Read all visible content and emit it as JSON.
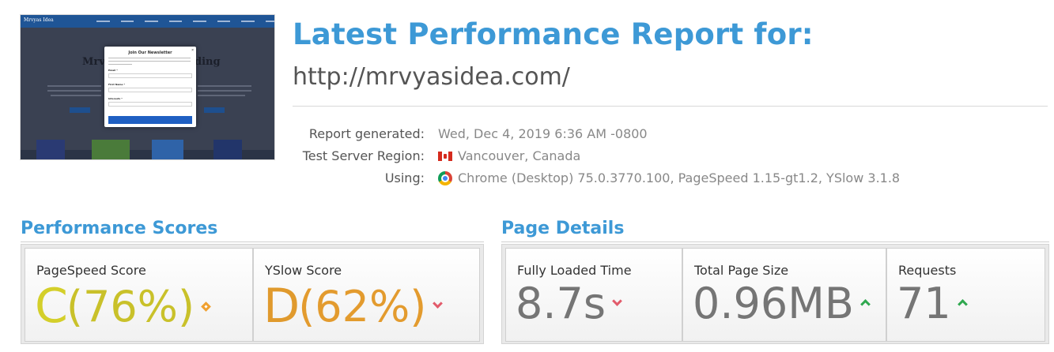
{
  "thumbnail": {
    "site_logo": "Mrvyas Idea",
    "hero_title_left": "Mrv",
    "hero_title_right": "ding",
    "modal_title": "Join Our Newsletter",
    "modal_close": "×",
    "modal_labels": [
      "Email *",
      "First Name *",
      "Interests *"
    ]
  },
  "header": {
    "title": "Latest Performance Report for:",
    "url": "http://mrvyasidea.com/"
  },
  "report_meta": [
    {
      "label": "Report generated:",
      "value": "Wed, Dec 4, 2019 6:36 AM -0800",
      "icon": ""
    },
    {
      "label": "Test Server Region:",
      "value": "Vancouver, Canada",
      "icon": "canada-flag-icon"
    },
    {
      "label": "Using:",
      "value": "Chrome (Desktop) 75.0.3770.100, PageSpeed 1.15-gt1.2, YSlow 3.1.8",
      "icon": "chrome-icon"
    }
  ],
  "performance_scores": {
    "heading": "Performance Scores",
    "pagespeed": {
      "label": "PageSpeed Score",
      "grade": "C",
      "percent": "(76%)",
      "trend": "neutral",
      "grade_color": "#d4cf2a",
      "percent_color": "#c9c12a"
    },
    "yslow": {
      "label": "YSlow Score",
      "grade": "D",
      "percent": "(62%)",
      "trend": "down",
      "grade_color": "#e09a2d",
      "percent_color": "#e39b2e"
    }
  },
  "page_details": {
    "heading": "Page Details",
    "fully_loaded": {
      "label": "Fully Loaded Time",
      "value": "8.7s",
      "trend": "down"
    },
    "page_size": {
      "label": "Total Page Size",
      "value": "0.96MB",
      "trend": "up"
    },
    "requests": {
      "label": "Requests",
      "value": "71",
      "trend": "up"
    }
  },
  "colors": {
    "accent_blue": "#3d99d6",
    "trend_down": "#e25b6b",
    "trend_up": "#2fa84f",
    "trend_neutral": "#f0a030"
  }
}
